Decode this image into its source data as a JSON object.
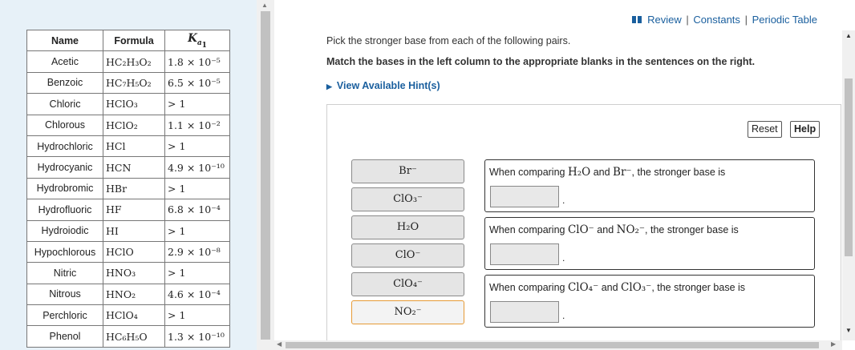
{
  "table": {
    "headers": {
      "name": "Name",
      "formula": "Formula"
    },
    "rows": [
      {
        "name": "Acetic",
        "formula": "HC₂H₃O₂",
        "ka": "1.8 × 10⁻⁵"
      },
      {
        "name": "Benzoic",
        "formula": "HC₇H₅O₂",
        "ka": "6.5 × 10⁻⁵"
      },
      {
        "name": "Chloric",
        "formula": "HClO₃",
        "ka": "> 1"
      },
      {
        "name": "Chlorous",
        "formula": "HClO₂",
        "ka": "1.1 × 10⁻²"
      },
      {
        "name": "Hydrochloric",
        "formula": "HCl",
        "ka": "> 1"
      },
      {
        "name": "Hydrocyanic",
        "formula": "HCN",
        "ka": "4.9 × 10⁻¹⁰"
      },
      {
        "name": "Hydrobromic",
        "formula": "HBr",
        "ka": "> 1"
      },
      {
        "name": "Hydrofluoric",
        "formula": "HF",
        "ka": "6.8 × 10⁻⁴"
      },
      {
        "name": "Hydroiodic",
        "formula": "HI",
        "ka": "> 1"
      },
      {
        "name": "Hypochlorous",
        "formula": "HClO",
        "ka": "2.9 × 10⁻⁸"
      },
      {
        "name": "Nitric",
        "formula": "HNO₃",
        "ka": "> 1"
      },
      {
        "name": "Nitrous",
        "formula": "HNO₂",
        "ka": "4.6 × 10⁻⁴"
      },
      {
        "name": "Perchloric",
        "formula": "HClO₄",
        "ka": "> 1"
      },
      {
        "name": "Phenol",
        "formula": "HC₆H₅O",
        "ka": "1.3 × 10⁻¹⁰"
      }
    ]
  },
  "topnav": {
    "review": "Review",
    "constants": "Constants",
    "periodic": "Periodic Table",
    "sep": "|"
  },
  "question": {
    "line1": "Pick the stronger base from each of the following pairs.",
    "line2": "Match the bases in the left column to the appropriate blanks in the sentences on the right.",
    "hint": "View Available Hint(s)"
  },
  "buttons": {
    "reset": "Reset",
    "help": "Help"
  },
  "chips": [
    "Br⁻",
    "ClO₃⁻",
    "H₂O",
    "ClO⁻",
    "ClO₄⁻",
    "NO₂⁻"
  ],
  "sentences": [
    {
      "p1": "When comparing ",
      "a": "H₂O",
      "p2": " and ",
      "b": "Br⁻",
      "p3": ", the stronger base is"
    },
    {
      "p1": "When comparing ",
      "a": "ClO⁻",
      "p2": " and ",
      "b": "NO₂⁻",
      "p3": ", the stronger base is"
    },
    {
      "p1": "When comparing ",
      "a": "ClO₄⁻",
      "p2": " and ",
      "b": "ClO₃⁻",
      "p3": ", the stronger base is"
    }
  ],
  "colors": {
    "link": "#1a5f9e",
    "panel": "#e7f1f8",
    "selected_border": "#e69a36"
  }
}
